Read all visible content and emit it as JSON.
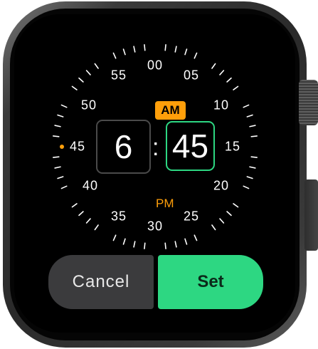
{
  "picker": {
    "minute_labels": [
      "00",
      "05",
      "10",
      "15",
      "20",
      "25",
      "30",
      "35",
      "40",
      "45",
      "50",
      "55"
    ],
    "am_label": "AM",
    "pm_label": "PM",
    "hour_value": "6",
    "separator": ":",
    "minute_value": "45",
    "selected_period": "AM"
  },
  "buttons": {
    "cancel_label": "Cancel",
    "set_label": "Set"
  },
  "colors": {
    "accent_orange": "#ff9f0a",
    "accent_green": "#2dd782",
    "screen_bg": "#000000"
  }
}
